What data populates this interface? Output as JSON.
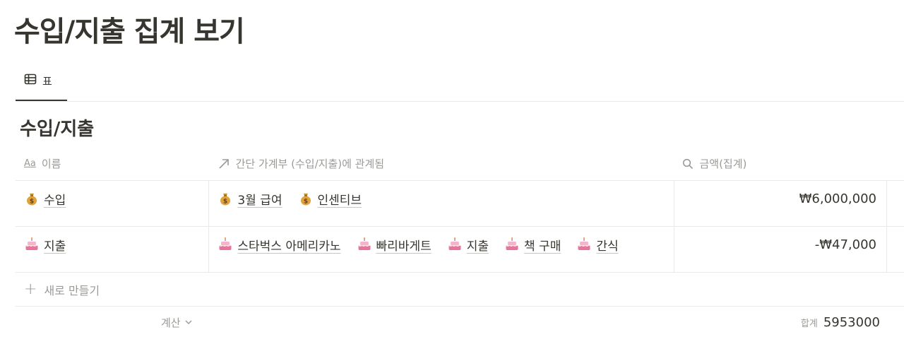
{
  "page": {
    "title": "수입/지출 집계 보기"
  },
  "view_tab": {
    "icon": "table-icon",
    "label": "표"
  },
  "database": {
    "title": "수입/지출"
  },
  "columns": {
    "name": {
      "icon": "text-aa-icon",
      "icon_text": "Aa",
      "label": "이름"
    },
    "relation": {
      "icon": "relation-arrow-icon",
      "label": "간단 가계부 (수입/지출)에 관계됨"
    },
    "amount": {
      "icon": "search-icon",
      "label": "금액(집계)"
    }
  },
  "rows": [
    {
      "name": "수입",
      "icon": "money-bag-icon",
      "relations": [
        {
          "label": "3월 급여",
          "icon": "money-bag-icon"
        },
        {
          "label": "인센티브",
          "icon": "money-bag-icon"
        }
      ],
      "amount": "₩6,000,000"
    },
    {
      "name": "지출",
      "icon": "cake-icon",
      "relations": [
        {
          "label": "스타벅스 아메리카노",
          "icon": "cake-icon"
        },
        {
          "label": "빠리바게트",
          "icon": "cake-icon"
        },
        {
          "label": "지출",
          "icon": "cake-icon"
        },
        {
          "label": "책 구매",
          "icon": "cake-icon"
        },
        {
          "label": "간식",
          "icon": "cake-icon"
        }
      ],
      "amount": "-₩47,000"
    }
  ],
  "new_row": {
    "label": "새로 만들기"
  },
  "footer": {
    "calc_label": "계산",
    "sum_label": "합계",
    "sum_value": "5953000"
  },
  "colors": {
    "text": "#37352f",
    "muted": "#9b9a97",
    "border": "#e9e9e7",
    "cake": "#e8739b"
  }
}
